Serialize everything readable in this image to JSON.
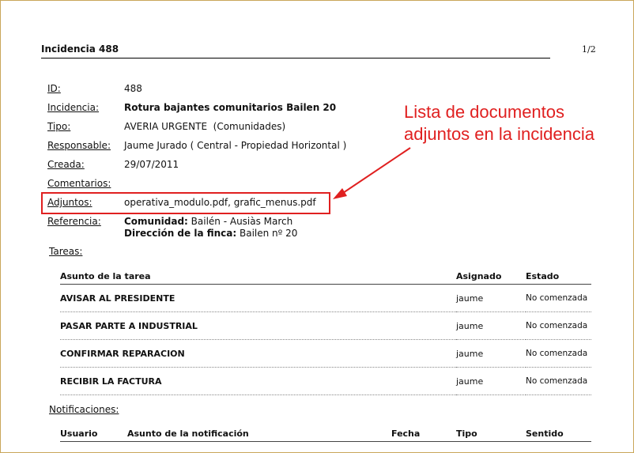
{
  "header": {
    "title": "Incidencia 488",
    "page": "1/2"
  },
  "fields": {
    "id": {
      "label": "ID:",
      "value": "488"
    },
    "incidencia": {
      "label": "Incidencia:",
      "value": "Rotura bajantes comunitarios Bailen 20"
    },
    "tipo": {
      "label": "Tipo:",
      "value": "AVERIA URGENTE  (Comunidades)"
    },
    "responsable": {
      "label": "Responsable:",
      "value": "Jaume Jurado ( Central - Propiedad Horizontal )"
    },
    "creada": {
      "label": "Creada:",
      "value": "29/07/2011"
    },
    "comentarios": {
      "label": "Comentarios:",
      "value": ""
    },
    "adjuntos": {
      "label": "Adjuntos:",
      "value": "operativa_modulo.pdf, grafic_menus.pdf"
    },
    "referencia": {
      "label": "Referencia:",
      "comunidad_label": "Comunidad:",
      "comunidad_value": " Bailén - Ausiàs March",
      "direccion_label": "Dirección de la finca:",
      "direccion_value": " Bailen nº 20"
    }
  },
  "annotation": {
    "line1": "Lista de documentos",
    "line2": "adjuntos en la incidencia",
    "color": "#e02020"
  },
  "tareas": {
    "title": "Tareas:",
    "columns": [
      "Asunto de la tarea",
      "Asignado",
      "Estado"
    ],
    "rows": [
      [
        "AVISAR AL PRESIDENTE",
        "jaume",
        "No comenzada"
      ],
      [
        "PASAR PARTE A INDUSTRIAL",
        "jaume",
        "No comenzada"
      ],
      [
        "CONFIRMAR REPARACION",
        "jaume",
        "No comenzada"
      ],
      [
        "RECIBIR LA FACTURA",
        "jaume",
        "No comenzada"
      ]
    ]
  },
  "notificaciones": {
    "title": "Notificaciones:",
    "columns": [
      "Usuario",
      "Asunto de la notificación",
      "Fecha",
      "Tipo",
      "Sentido"
    ]
  }
}
